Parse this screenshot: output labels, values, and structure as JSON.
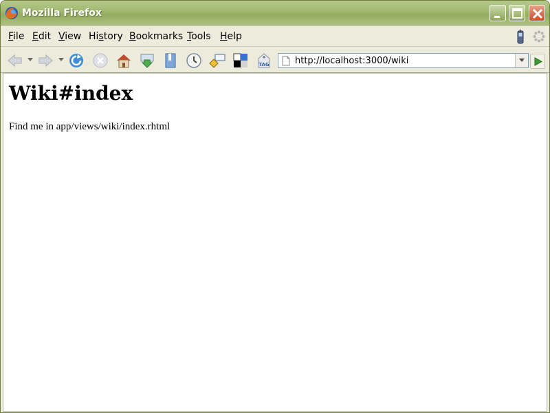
{
  "window": {
    "title": "Mozilla Firefox"
  },
  "menu": {
    "items": [
      {
        "mnemonic": "F",
        "rest": "ile"
      },
      {
        "mnemonic": "E",
        "rest": "dit"
      },
      {
        "mnemonic": "V",
        "rest": "iew"
      },
      {
        "pre": "Hi",
        "mnemonic": "s",
        "rest": "tory"
      },
      {
        "mnemonic": "B",
        "rest": "ookmarks"
      },
      {
        "mnemonic": "T",
        "rest": "ools"
      },
      {
        "mnemonic": "H",
        "rest": "elp"
      }
    ]
  },
  "toolbar": {
    "icons": [
      "back-icon",
      "forward-icon",
      "reload-icon",
      "stop-icon",
      "home-icon",
      "download-icon",
      "bookmarks-icon",
      "history-icon",
      "signpost-icon",
      "delicious-icon",
      "tag-icon"
    ],
    "tag_label": "TAG"
  },
  "address": {
    "url": "http://localhost:3000/wiki"
  },
  "page": {
    "heading": "Wiki#index",
    "body": "Find me in app/views/wiki/index.rhtml"
  },
  "colors": {
    "titlebar": "#a3ba72",
    "chrome": "#ecebdc"
  }
}
